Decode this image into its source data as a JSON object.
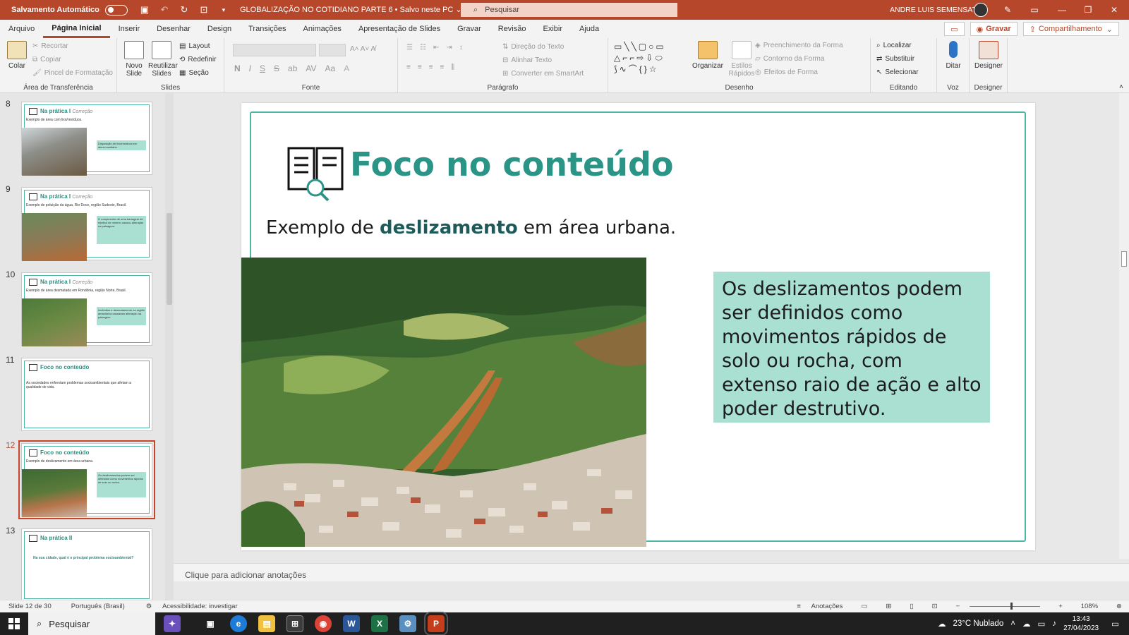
{
  "titlebar": {
    "autosave_label": "Salvamento Automático",
    "doc_title": "GLOBALIZAÇÃO NO COTIDIANO PARTE 6 • Salvo neste PC ⌄",
    "search_placeholder": "Pesquisar",
    "user_name": "ANDRE LUIS SEMENSATO"
  },
  "menu": {
    "tabs": [
      "Arquivo",
      "Página Inicial",
      "Inserir",
      "Desenhar",
      "Design",
      "Transições",
      "Animações",
      "Apresentação de Slides",
      "Gravar",
      "Revisão",
      "Exibir",
      "Ajuda"
    ],
    "record_label": "Gravar",
    "share_label": "Compartilhamento"
  },
  "ribbon": {
    "clipboard": {
      "paste": "Colar",
      "cut": "Recortar",
      "copy": "Copiar",
      "format_painter": "Pincel de Formatação",
      "label": "Área de Transferência"
    },
    "slides": {
      "new_slide": "Novo Slide",
      "reuse_slides": "Reutilizar Slides",
      "layout": "Layout",
      "reset": "Redefinir",
      "section": "Seção",
      "label": "Slides"
    },
    "font": {
      "label": "Fonte"
    },
    "paragraph": {
      "text_direction": "Direção do Texto",
      "align_text": "Alinhar Texto",
      "smartart": "Converter em SmartArt",
      "label": "Parágrafo"
    },
    "drawing": {
      "arrange": "Organizar",
      "quick_styles": "Estilos Rápidos",
      "fill": "Preenchimento da Forma",
      "outline": "Contorno da Forma",
      "effects": "Efeitos de Forma",
      "label": "Desenho"
    },
    "editing": {
      "find": "Localizar",
      "replace": "Substituir",
      "select": "Selecionar",
      "label": "Editando"
    },
    "voice": {
      "dictate": "Ditar",
      "label": "Voz"
    },
    "designer": {
      "designer": "Designer",
      "label": "Designer"
    }
  },
  "thumbnails": [
    {
      "num": "8",
      "title": "Na prática I",
      "tag": "Correção",
      "sub": "Exemplo de área com lixo/resíduos.",
      "note": "Disposição de lixo/resíduos em aterro sanitário."
    },
    {
      "num": "9",
      "title": "Na prática I",
      "tag": "Correção",
      "sub": "Exemplo de poluição da água, Rio Doce, região Sudeste, Brasil.",
      "note": "O rompimento de uma barragem de rejeitos de minério causou alteração na paisagem."
    },
    {
      "num": "10",
      "title": "Na prática I",
      "tag": "Correção",
      "sub": "Exemplo de área desmatada em Rondônia, região Norte, Brasil.",
      "note": "Incêndios e desmatamento na região amazônica causaram alteração na paisagem."
    },
    {
      "num": "11",
      "title": "Foco no conteúdo",
      "tag": "",
      "sub": "As sociedades enfrentam problemas socioambientais que afetam a qualidade de vida.",
      "note": ""
    },
    {
      "num": "12",
      "title": "Foco no conteúdo",
      "tag": "",
      "sub": "Exemplo de deslizamento em área urbana.",
      "note": "Os deslizamentos podem ser definidos como movimentos rápidos de solo ou rocha."
    },
    {
      "num": "13",
      "title": "Na prática II",
      "tag": "",
      "sub": "Na sua cidade, qual é o principal problema socioambiental?",
      "note": ""
    }
  ],
  "slide": {
    "title": "Foco no conteúdo",
    "subtitle_pre": "Exemplo de ",
    "subtitle_bold": "deslizamento",
    "subtitle_post": " em área urbana.",
    "note": "Os deslizamentos podem ser definidos como movimentos rápidos de solo ou rocha, com extenso raio de ação e alto poder destrutivo."
  },
  "notes_placeholder": "Clique para adicionar anotações",
  "status": {
    "slide_count": "Slide 12 de 30",
    "language": "Português (Brasil)",
    "accessibility": "Acessibilidade: investigar",
    "notes": "Anotações",
    "zoom": "108%"
  },
  "taskbar": {
    "search": "Pesquisar",
    "weather": "23°C  Nublado",
    "time": "13:43",
    "date": "27/04/2023"
  },
  "colors": {
    "accent": "#b7472a",
    "teal": "#2a9587",
    "note_bg": "#a9e0d2"
  }
}
